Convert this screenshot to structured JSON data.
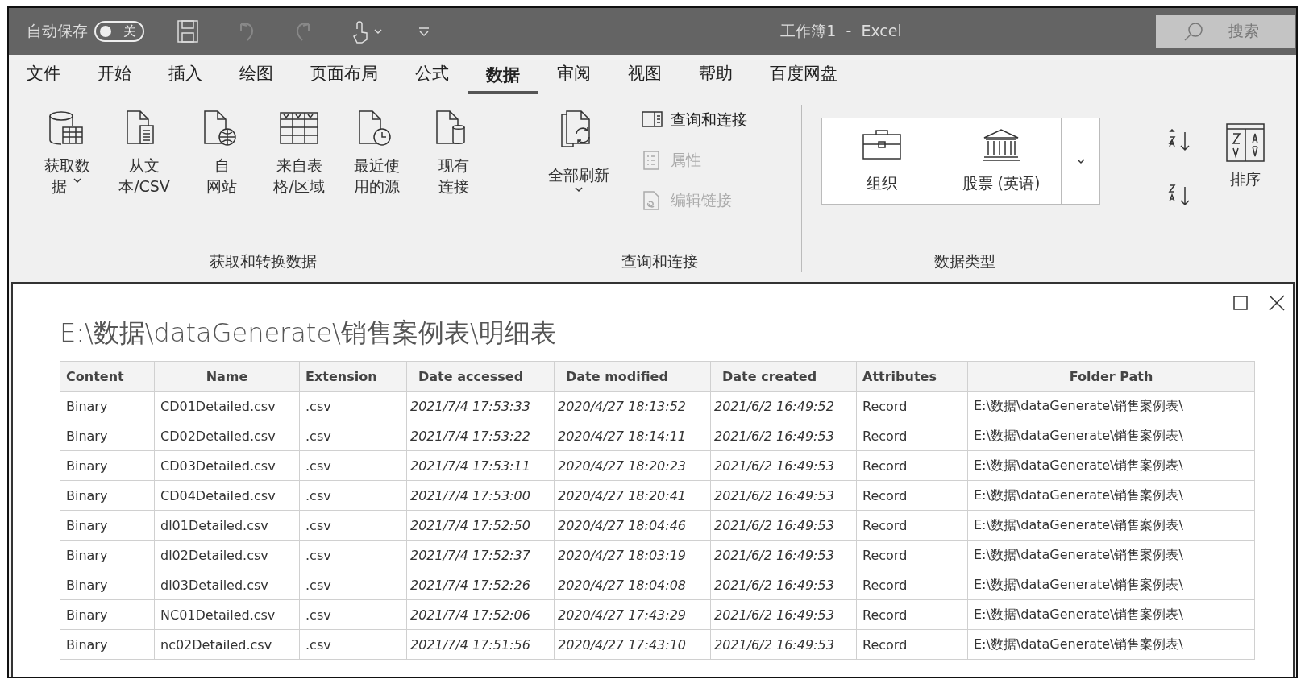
{
  "title_bar": {
    "autosave": {
      "label": "自动保存",
      "on": false,
      "state_label": "关"
    },
    "title": "工作簿1  -  Excel",
    "search": {
      "placeholder": "搜索"
    }
  },
  "tabs": [
    {
      "label": "文件",
      "selected": false
    },
    {
      "label": "开始",
      "selected": false
    },
    {
      "label": "插入",
      "selected": false
    },
    {
      "label": "绘图",
      "selected": false
    },
    {
      "label": "页面布局",
      "selected": false
    },
    {
      "label": "公式",
      "selected": false
    },
    {
      "label": "数据",
      "selected": true
    },
    {
      "label": "审阅",
      "selected": false
    },
    {
      "label": "视图",
      "selected": false
    },
    {
      "label": "帮助",
      "selected": false
    },
    {
      "label": "百度网盘",
      "selected": false
    }
  ],
  "ribbon": {
    "get_transform": {
      "title": "获取和转换数据",
      "buttons": [
        {
          "kind": "database",
          "lines": [
            "获取数",
            "据"
          ],
          "dropdown": true
        },
        {
          "kind": "text-file",
          "lines": [
            "从文",
            "本/CSV"
          ],
          "dropdown": false
        },
        {
          "kind": "web",
          "lines": [
            "自",
            "网站"
          ],
          "dropdown": false
        },
        {
          "kind": "table",
          "lines": [
            "来自表",
            "格/区域"
          ],
          "dropdown": false
        },
        {
          "kind": "recent",
          "lines": [
            "最近使",
            "用的源"
          ],
          "dropdown": false
        },
        {
          "kind": "connection",
          "lines": [
            "现有",
            "连接"
          ],
          "dropdown": false
        }
      ]
    },
    "queries": {
      "title": "查询和连接",
      "refresh": {
        "label": "全部刷新"
      },
      "items": [
        {
          "kind": "panel",
          "label": "查询和连接",
          "disabled": false
        },
        {
          "kind": "properties",
          "label": "属性",
          "disabled": true
        },
        {
          "kind": "links",
          "label": "编辑链接",
          "disabled": true
        }
      ]
    },
    "data_types": {
      "title": "数据类型",
      "items": [
        {
          "kind": "briefcase",
          "label": "组织"
        },
        {
          "kind": "bank",
          "label": "股票 (英语)"
        }
      ]
    },
    "sort": {
      "button": {
        "label": "排序"
      }
    }
  },
  "dialog": {
    "title": "E:\\数据\\dataGenerate\\销售案例表\\明细表",
    "table": {
      "columns": [
        {
          "label": "Content",
          "kind": "text"
        },
        {
          "label": "Name",
          "kind": "text"
        },
        {
          "label": "Extension",
          "kind": "text"
        },
        {
          "label": "Date accessed",
          "kind": "date"
        },
        {
          "label": "Date modified",
          "kind": "date"
        },
        {
          "label": "Date created",
          "kind": "date"
        },
        {
          "label": "Attributes",
          "kind": "text"
        },
        {
          "label": "Folder Path",
          "kind": "text"
        }
      ],
      "rows": [
        [
          "Binary",
          "CD01Detailed.csv",
          ".csv",
          "2021/7/4 17:53:33",
          "2020/4/27 18:13:52",
          "2021/6/2 16:49:52",
          "Record",
          "E:\\数据\\dataGenerate\\销售案例表\\"
        ],
        [
          "Binary",
          "CD02Detailed.csv",
          ".csv",
          "2021/7/4 17:53:22",
          "2020/4/27 18:14:11",
          "2021/6/2 16:49:53",
          "Record",
          "E:\\数据\\dataGenerate\\销售案例表\\"
        ],
        [
          "Binary",
          "CD03Detailed.csv",
          ".csv",
          "2021/7/4 17:53:11",
          "2020/4/27 18:20:23",
          "2021/6/2 16:49:53",
          "Record",
          "E:\\数据\\dataGenerate\\销售案例表\\"
        ],
        [
          "Binary",
          "CD04Detailed.csv",
          ".csv",
          "2021/7/4 17:53:00",
          "2020/4/27 18:20:41",
          "2021/6/2 16:49:53",
          "Record",
          "E:\\数据\\dataGenerate\\销售案例表\\"
        ],
        [
          "Binary",
          "dl01Detailed.csv",
          ".csv",
          "2021/7/4 17:52:50",
          "2020/4/27 18:04:46",
          "2021/6/2 16:49:53",
          "Record",
          "E:\\数据\\dataGenerate\\销售案例表\\"
        ],
        [
          "Binary",
          "dl02Detailed.csv",
          ".csv",
          "2021/7/4 17:52:37",
          "2020/4/27 18:03:19",
          "2021/6/2 16:49:53",
          "Record",
          "E:\\数据\\dataGenerate\\销售案例表\\"
        ],
        [
          "Binary",
          "dl03Detailed.csv",
          ".csv",
          "2021/7/4 17:52:26",
          "2020/4/27 18:04:08",
          "2021/6/2 16:49:53",
          "Record",
          "E:\\数据\\dataGenerate\\销售案例表\\"
        ],
        [
          "Binary",
          "NC01Detailed.csv",
          ".csv",
          "2021/7/4 17:52:06",
          "2020/4/27 17:43:29",
          "2021/6/2 16:49:53",
          "Record",
          "E:\\数据\\dataGenerate\\销售案例表\\"
        ],
        [
          "Binary",
          "nc02Detailed.csv",
          ".csv",
          "2021/7/4 17:51:56",
          "2020/4/27 17:43:10",
          "2021/6/2 16:49:53",
          "Record",
          "E:\\数据\\dataGenerate\\销售案例表\\"
        ]
      ]
    }
  }
}
